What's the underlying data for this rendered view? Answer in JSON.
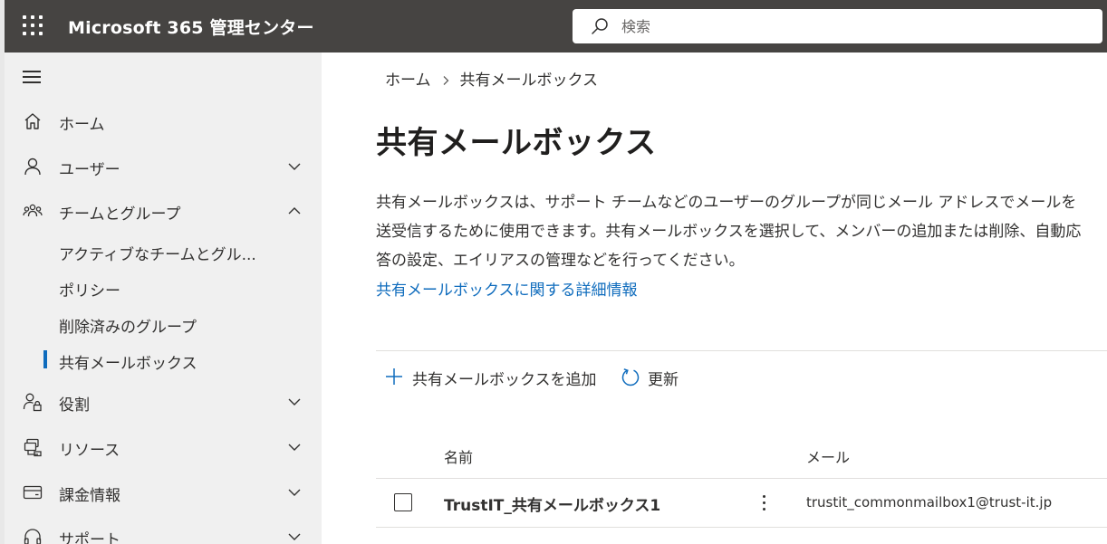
{
  "header": {
    "app_title": "Microsoft 365 管理センター",
    "search_placeholder": "検索"
  },
  "sidebar": {
    "items": [
      {
        "label": "ホーム",
        "icon": "home-icon"
      },
      {
        "label": "ユーザー",
        "icon": "user-icon"
      },
      {
        "label": "チームとグループ",
        "icon": "teams-groups-icon"
      },
      {
        "label": "役割",
        "icon": "roles-icon"
      },
      {
        "label": "リソース",
        "icon": "resources-icon"
      },
      {
        "label": "課金情報",
        "icon": "billing-card-icon"
      },
      {
        "label": "サポート",
        "icon": "headset-icon"
      }
    ],
    "sub_items": [
      {
        "label": "アクティブなチームとグル..."
      },
      {
        "label": "ポリシー"
      },
      {
        "label": "削除済みのグループ"
      },
      {
        "label": "共有メールボックス",
        "selected": true
      }
    ]
  },
  "breadcrumb": {
    "home": "ホーム",
    "current": "共有メールボックス"
  },
  "page": {
    "title": "共有メールボックス",
    "description": "共有メールボックスは、サポート チームなどのユーザーのグループが同じメール アドレスでメールを送受信するために使用できます。共有メールボックスを選択して、メンバーの追加または削除、自動応答の設定、エイリアスの管理などを行ってください。",
    "learn_more": "共有メールボックスに関する詳細情報"
  },
  "toolbar": {
    "add_label": "共有メールボックスを追加",
    "refresh_label": "更新"
  },
  "table": {
    "columns": [
      "名前",
      "メール"
    ],
    "rows": [
      {
        "name": "TrustIT_共有メールボックス1",
        "email": "trustit_commonmailbox1@trust-it.jp"
      }
    ]
  },
  "colors": {
    "topbar": "#464442",
    "sidebar": "#f0f0f0",
    "accent": "#0f6cbd"
  }
}
